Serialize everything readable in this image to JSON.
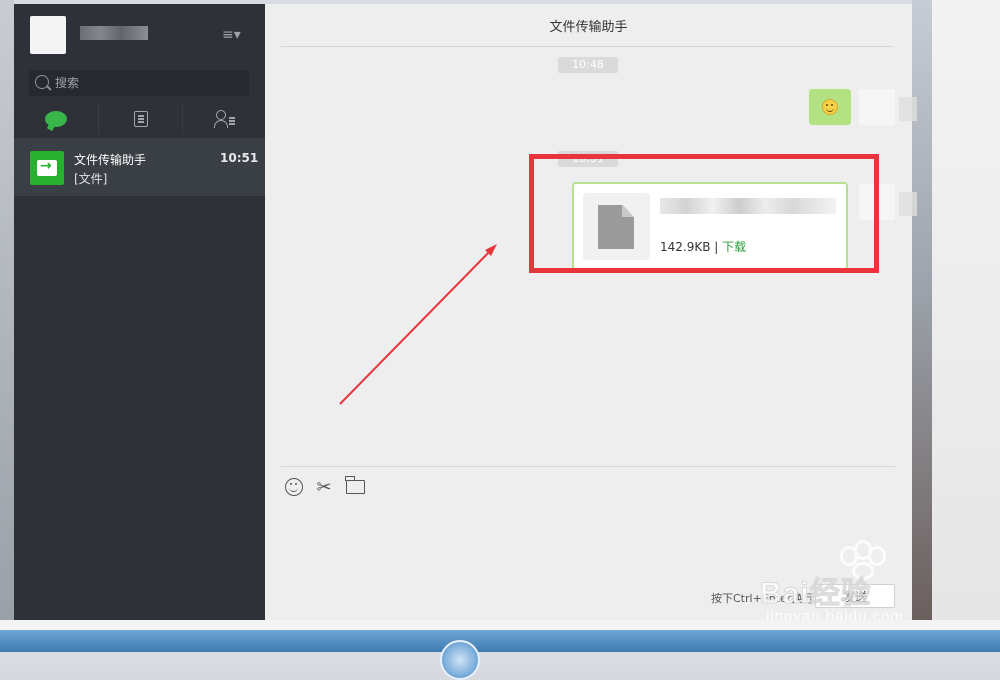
{
  "sidebar": {
    "search_placeholder": "搜索",
    "menu_icon": "menu-lines-icon",
    "tabs": [
      {
        "name": "chats",
        "icon": "chat-bubble-icon",
        "active": true
      },
      {
        "name": "articles",
        "icon": "document-list-icon",
        "active": false
      },
      {
        "name": "contacts",
        "icon": "contacts-icon",
        "active": false
      }
    ],
    "chat_list": [
      {
        "name": "文件传输助手",
        "preview": "[文件]",
        "time": "10:51",
        "avatar_icon": "file-transfer-icon"
      }
    ],
    "active_tab_color": "#39b54a"
  },
  "chat": {
    "title": "文件传输助手",
    "time_badges": [
      "10:48",
      "10:51"
    ],
    "file_message": {
      "size": "142.9KB",
      "separator": "|",
      "action": "下载"
    },
    "highlight_color": "#e8343a"
  },
  "composer": {
    "tools": [
      "emoji-icon",
      "scissors-icon",
      "folder-icon"
    ],
    "hint": "按下Ctrl+Enter换行",
    "send_label": "发送"
  },
  "watermark": {
    "text": "Bai",
    "text2": "经验",
    "sub": "jingyan.baidu.com"
  }
}
